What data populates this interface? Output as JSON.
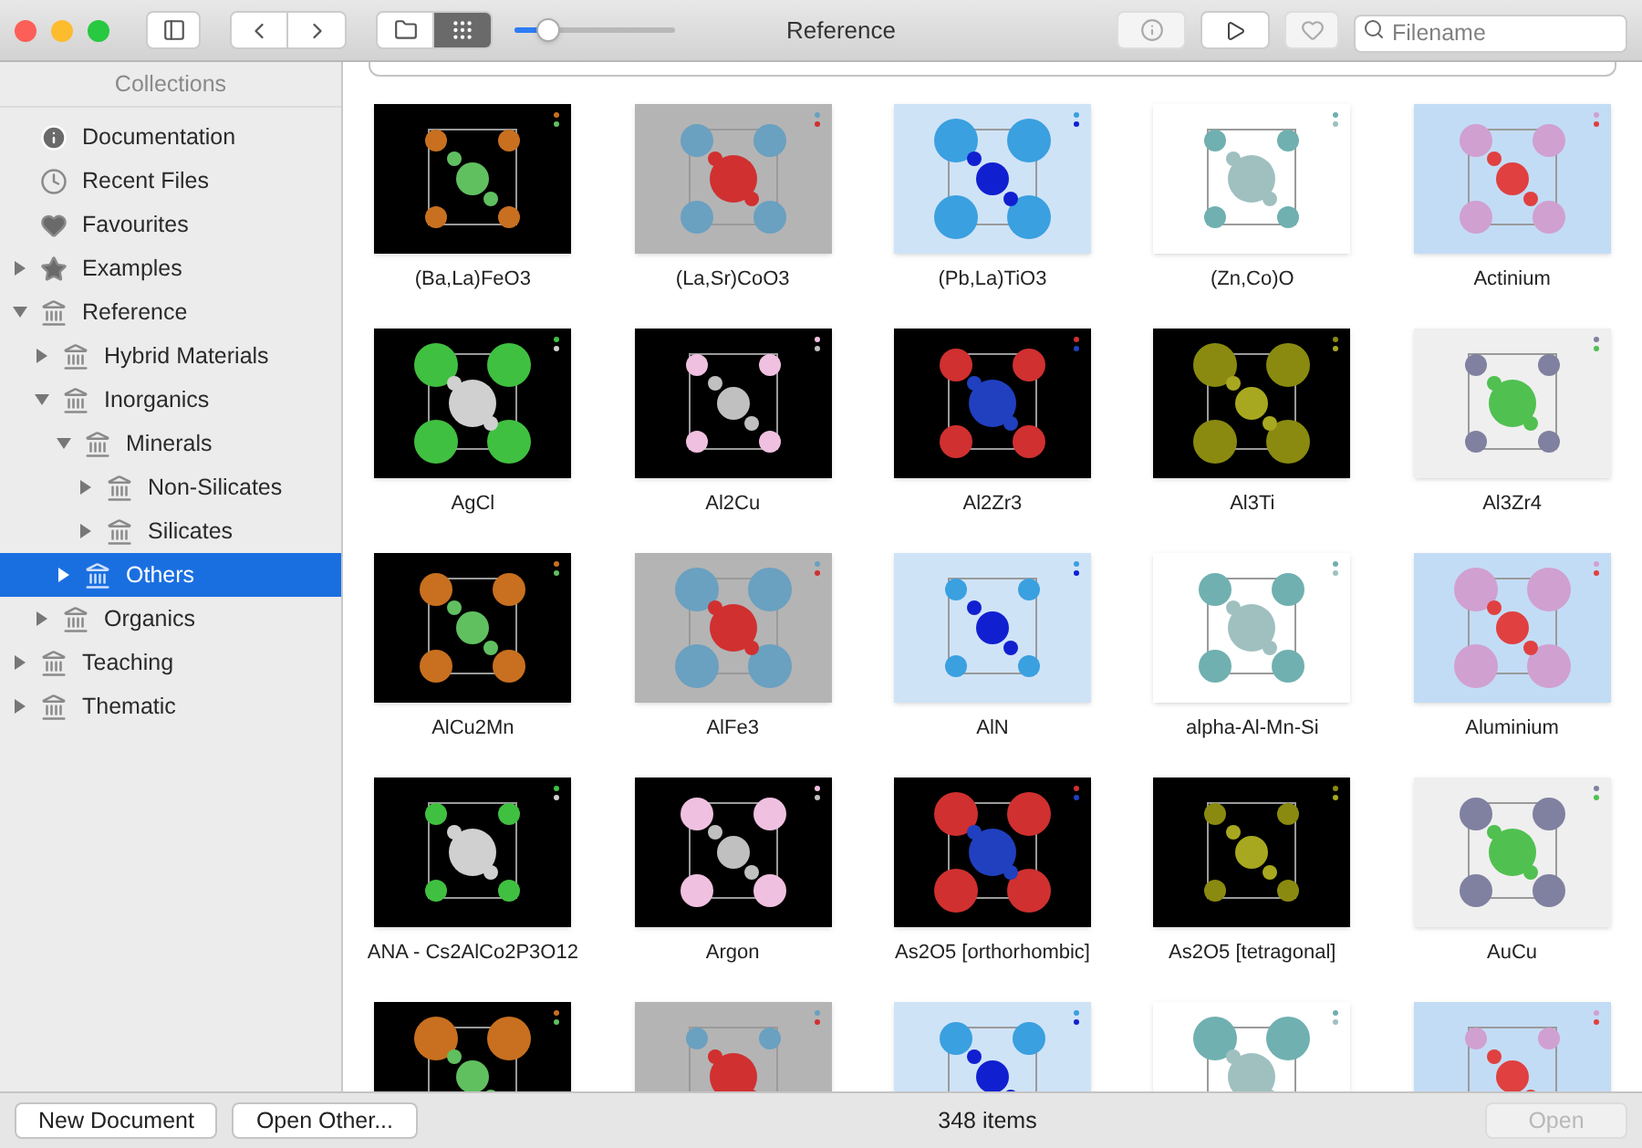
{
  "window": {
    "title": "Reference"
  },
  "toolbar": {
    "zoom": {
      "level": 0.2
    },
    "view_modes": [
      {
        "kind": "folder",
        "selected": false
      },
      {
        "kind": "grid",
        "selected": true
      }
    ],
    "search": {
      "placeholder": "Filename"
    }
  },
  "sidebar": {
    "header": "Collections",
    "items": [
      {
        "label": "Documentation",
        "kind": "info",
        "selected": false
      },
      {
        "label": "Recent Files",
        "kind": "clock",
        "selected": false
      },
      {
        "label": "Favourites",
        "kind": "heart",
        "selected": false
      },
      {
        "label": "Examples",
        "kind": "star",
        "expanded": false,
        "selected": false
      },
      {
        "label": "Reference",
        "kind": "library",
        "expanded": true,
        "selected": false,
        "children": [
          {
            "label": "Hybrid Materials",
            "kind": "library",
            "expanded": false,
            "selected": false
          },
          {
            "label": "Inorganics",
            "kind": "library",
            "expanded": true,
            "selected": false,
            "children": [
              {
                "label": "Minerals",
                "kind": "library",
                "expanded": true,
                "selected": false,
                "children": [
                  {
                    "label": "Non-Silicates",
                    "kind": "library",
                    "expanded": false,
                    "selected": false
                  },
                  {
                    "label": "Silicates",
                    "kind": "library",
                    "expanded": false,
                    "selected": false
                  }
                ]
              },
              {
                "label": "Others",
                "kind": "library",
                "expanded": false,
                "selected": true
              }
            ]
          },
          {
            "label": "Organics",
            "kind": "library",
            "expanded": false,
            "selected": false
          }
        ]
      },
      {
        "label": "Teaching",
        "kind": "library",
        "expanded": false,
        "selected": false
      },
      {
        "label": "Thematic",
        "kind": "library",
        "expanded": false,
        "selected": false
      }
    ]
  },
  "grid": {
    "items": [
      {
        "kind": "picture",
        "label": "(Ba,La)FeO3"
      },
      {
        "kind": "picture",
        "label": "(La,Sr)CoO3"
      },
      {
        "kind": "picture",
        "label": "(Pb,La)TiO3"
      },
      {
        "kind": "picture",
        "label": "(Zn,Co)O"
      },
      {
        "kind": "picture",
        "label": "Actinium"
      },
      {
        "kind": "picture",
        "label": "AgCl"
      },
      {
        "kind": "picture",
        "label": "Al2Cu"
      },
      {
        "kind": "picture",
        "label": "Al2Zr3"
      },
      {
        "kind": "picture",
        "label": "Al3Ti"
      },
      {
        "kind": "picture",
        "label": "Al3Zr4"
      },
      {
        "kind": "picture",
        "label": "AlCu2Mn"
      },
      {
        "kind": "picture",
        "label": "AlFe3"
      },
      {
        "kind": "picture",
        "label": "AlN"
      },
      {
        "kind": "picture",
        "label": "alpha-Al-Mn-Si"
      },
      {
        "kind": "picture",
        "label": "Aluminium"
      },
      {
        "kind": "picture",
        "label": "ANA - Cs2AlCo2P3O12"
      },
      {
        "kind": "picture",
        "label": "Argon"
      },
      {
        "kind": "picture",
        "label": "As2O5 [orthorhombic]"
      },
      {
        "kind": "picture",
        "label": "As2O5 [tetragonal]"
      },
      {
        "kind": "picture",
        "label": "AuCu"
      },
      {
        "kind": "picture"
      },
      {
        "kind": "picture"
      },
      {
        "kind": "picture"
      },
      {
        "kind": "picture"
      },
      {
        "kind": "picture"
      }
    ]
  },
  "bottom_bar": {
    "buttons": [
      "New Document",
      "Open Other..."
    ],
    "count": "348 items",
    "open_button": {
      "label": "Open",
      "disabled": true
    }
  }
}
